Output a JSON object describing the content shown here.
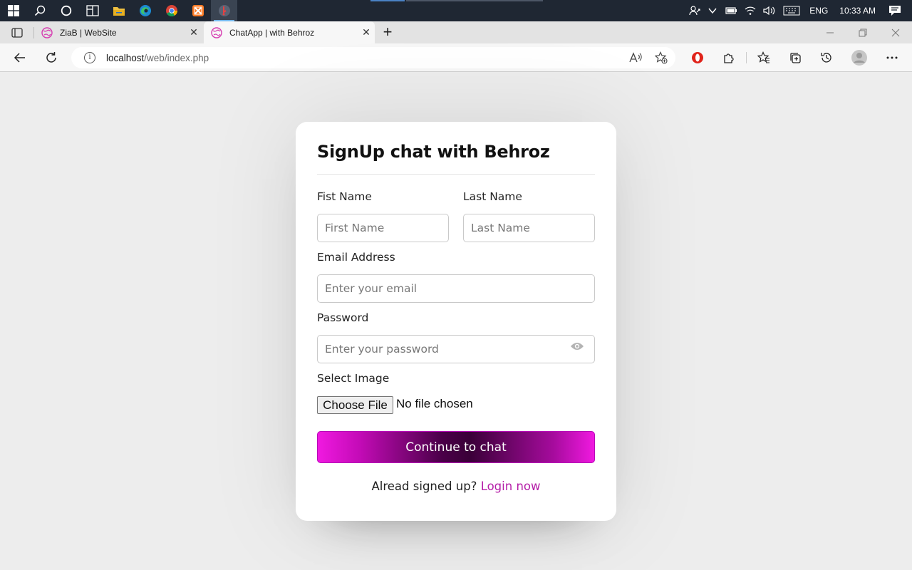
{
  "taskbar": {
    "icons": [
      "windows-start-icon",
      "search-icon",
      "task-view-icon",
      "widgets-icon",
      "file-explorer-icon",
      "edge-icon",
      "chrome-icon",
      "xampp-icon",
      "active-app-icon"
    ],
    "tray": {
      "language": "ENG",
      "time": "10:33 AM"
    }
  },
  "browser": {
    "tabs": [
      {
        "label": "ZiaB | WebSite"
      },
      {
        "label": "ChatApp | with Behroz"
      }
    ],
    "url": {
      "host": "localhost",
      "path": "/web/index.php"
    }
  },
  "form": {
    "title": "SignUp chat with Behroz",
    "first_name_label": "Fist Name",
    "first_name_placeholder": "First Name",
    "last_name_label": "Last Name",
    "last_name_placeholder": "Last Name",
    "email_label": "Email Address",
    "email_placeholder": "Enter your email",
    "password_label": "Password",
    "password_placeholder": "Enter your password",
    "image_label": "Select Image",
    "file_button": "Choose File",
    "file_status": "No file chosen",
    "submit_label": "Continue to chat",
    "footer_text": "Alread signed up?",
    "login_link": "Login now"
  },
  "colors": {
    "accent": "#b51fa8",
    "button_gradient_edge": "#f019e0",
    "button_gradient_center": "#3a0038"
  }
}
